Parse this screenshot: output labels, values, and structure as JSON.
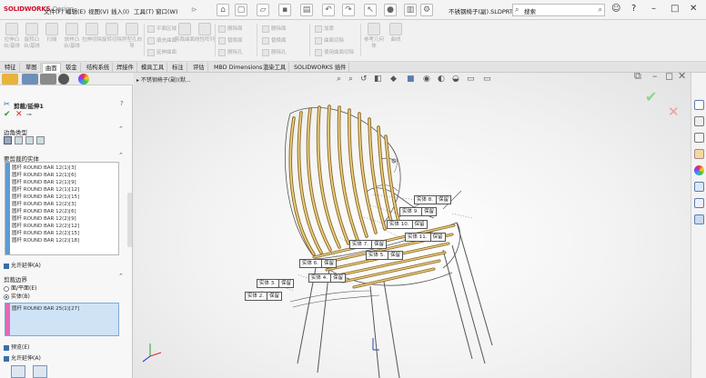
{
  "app": {
    "logo_main": "SOLIDWORKS",
    "logo_sub": "Design",
    "menus": [
      "文件(F)",
      "编辑(E)",
      "视图(V)",
      "插入(I)",
      "工具(T)",
      "窗口(W)"
    ],
    "doc_title": "不锈钢椅子(副).SLDPRT *",
    "search_placeholder": "搜索"
  },
  "ribbon": {
    "big": [
      "拉伸凸台/基体",
      "旋转凸台/基体",
      "扫描",
      "放样凸台/基体",
      "拉伸切除",
      "旋转切除",
      "异型孔向导",
      "圆角",
      "线性阵列"
    ],
    "group1": [
      "平面区域",
      "填充曲面",
      "剪裁曲面",
      "延伸曲面"
    ],
    "group2": [
      "删除面",
      "替换面",
      "删除孔"
    ],
    "group3": [
      "加厚",
      "曲面切除",
      "使用曲面切除"
    ],
    "group4": [
      "参考几何体",
      "曲线"
    ]
  },
  "tabs": [
    "特征",
    "草图",
    "曲面",
    "钣金",
    "结构系统",
    "焊接件",
    "模具工具",
    "标注",
    "评估",
    "MBD Dimensions",
    "渲染工具",
    "SOLIDWORKS 插件"
  ],
  "active_tab": "曲面",
  "breadcrumb": "不锈钢椅子(副)(默...",
  "pm": {
    "title": "剪裁/延伸1",
    "corner_type_label": "边角类型",
    "bodies_label": "要剪裁的实体",
    "bodies": [
      "圆杆 ROUND BAR 12(1)[3]",
      "圆杆 ROUND BAR 12(1)[6]",
      "圆杆 ROUND BAR 12(1)[9]",
      "圆杆 ROUND BAR 12(1)[12]",
      "圆杆 ROUND BAR 12(1)[15]",
      "圆杆 ROUND BAR 12(2)[3]",
      "圆杆 ROUND BAR 12(2)[6]",
      "圆杆 ROUND BAR 12(2)[9]",
      "圆杆 ROUND BAR 12(2)[12]",
      "圆杆 ROUND BAR 12(2)[15]",
      "圆杆 ROUND BAR 12(2)[18]"
    ],
    "allow_extend": "允许延伸(A)",
    "boundary_label": "剪裁边界",
    "opt_plane": "面/平面(E)",
    "opt_body": "实体(B)",
    "boundary_item": "圆杆 ROUND BAR 25(1)[27]",
    "preview": "预览(E)",
    "allow_extend2": "允许延伸(A)"
  },
  "callouts": [
    {
      "n": "实体 8.",
      "k": "保留"
    },
    {
      "n": "实体 9.",
      "k": "保留"
    },
    {
      "n": "实体 10.",
      "k": "保留"
    },
    {
      "n": "实体 11.",
      "k": "保留"
    },
    {
      "n": "实体 7.",
      "k": "保留"
    },
    {
      "n": "实体 5.",
      "k": "保留"
    },
    {
      "n": "实体 6.",
      "k": "保留"
    },
    {
      "n": "实体 4.",
      "k": "保留"
    },
    {
      "n": "实体 3.",
      "k": "保留"
    },
    {
      "n": "实体 2.",
      "k": "保留"
    }
  ]
}
